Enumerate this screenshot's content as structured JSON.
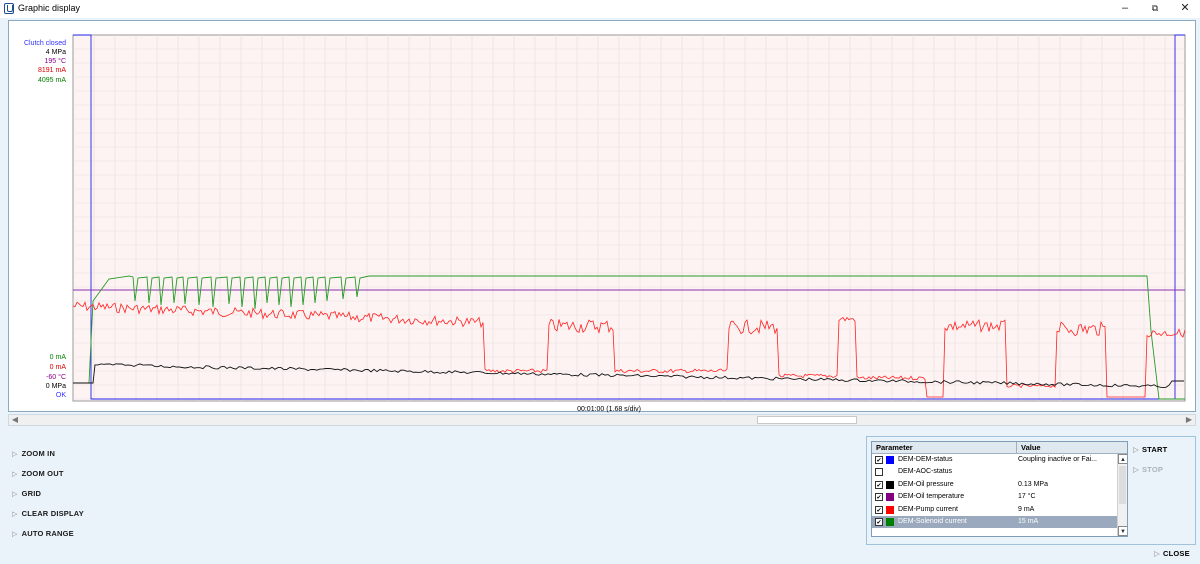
{
  "window": {
    "title": "Graphic display",
    "min": "–",
    "max": "⧉",
    "close": "✕"
  },
  "chart_scale_labels": [
    {
      "text": "Clutch closed",
      "color": "#3030ff"
    },
    {
      "text": "4 MPa",
      "color": "#000000"
    },
    {
      "text": "195 °C",
      "color": "#8b008b"
    },
    {
      "text": "8191 mA",
      "color": "#e00000"
    },
    {
      "text": "4095 mA",
      "color": "#008000"
    }
  ],
  "chart_scale_labels_bottom": [
    {
      "text": "0 mA",
      "color": "#008000"
    },
    {
      "text": "0 mA",
      "color": "#e00000"
    },
    {
      "text": "-60 °C",
      "color": "#8b008b"
    },
    {
      "text": "0 MPa",
      "color": "#000000"
    },
    {
      "text": "OK",
      "color": "#3030ff"
    }
  ],
  "time_label": "00:01:00 (1.68 s/div)",
  "left_buttons": [
    {
      "label": "ZOOM IN"
    },
    {
      "label": "ZOOM OUT"
    },
    {
      "label": "GRID"
    },
    {
      "label": "CLEAR DISPLAY"
    },
    {
      "label": "AUTO RANGE"
    }
  ],
  "param_table": {
    "headers": {
      "parameter": "Parameter",
      "value": "Value"
    },
    "rows": [
      {
        "checked": true,
        "color": "#0000ff",
        "name": "DEM-DEM-status",
        "value": "Coupling inactive or Fai...",
        "selected": false
      },
      {
        "checked": false,
        "color": "",
        "name": "DEM-AOC-status",
        "value": "",
        "selected": false
      },
      {
        "checked": true,
        "color": "#000000",
        "name": "DEM-Oil pressure",
        "value": "0.13 MPa",
        "selected": false
      },
      {
        "checked": true,
        "color": "#800080",
        "name": "DEM-Oil temperature",
        "value": "17 °C",
        "selected": false
      },
      {
        "checked": true,
        "color": "#ff0000",
        "name": "DEM-Pump current",
        "value": "9 mA",
        "selected": false
      },
      {
        "checked": true,
        "color": "#008000",
        "name": "DEM-Solenoid current",
        "value": "15 mA",
        "selected": true
      }
    ]
  },
  "right_buttons": {
    "start": "START",
    "stop": "STOP",
    "close": "CLOSE"
  },
  "icons": {
    "arrow": "▷",
    "check": "✔",
    "scroll_up": "▲",
    "scroll_down": "▼",
    "scroll_left": "◀",
    "scroll_right": "▶"
  }
}
